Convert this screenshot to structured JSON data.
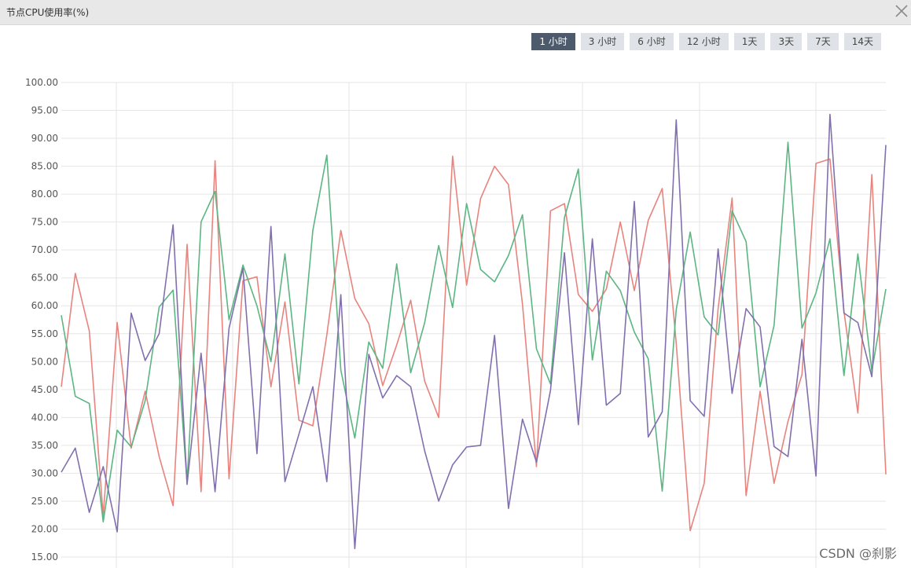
{
  "window": {
    "title": "节点CPU使用率(%)",
    "close_icon": "close-icon"
  },
  "range": {
    "options": [
      "1 小时",
      "3 小时",
      "6 小时",
      "12 小时",
      "1天",
      "3天",
      "7天",
      "14天"
    ],
    "selected": "1 小时"
  },
  "watermark": "CSDN @刹影",
  "chart_data": {
    "type": "line",
    "title": "",
    "xlabel": "",
    "ylabel": "",
    "ylim": [
      15,
      100
    ],
    "yticks": [
      "15.00",
      "20.00",
      "25.00",
      "30.00",
      "35.00",
      "40.00",
      "45.00",
      "50.00",
      "55.00",
      "60.00",
      "65.00",
      "70.00",
      "75.00",
      "80.00",
      "85.00",
      "90.00",
      "95.00",
      "100.00"
    ],
    "grid": true,
    "legend": "none",
    "x": [
      0,
      1,
      2,
      3,
      4,
      5,
      6,
      7,
      8,
      9,
      10,
      11,
      12,
      13,
      14,
      15,
      16,
      17,
      18,
      19,
      20,
      21,
      22,
      23,
      24,
      25,
      26,
      27,
      28,
      29,
      30,
      31,
      32,
      33,
      34,
      35,
      36,
      37,
      38,
      39,
      40,
      41,
      42,
      43,
      44,
      45,
      46,
      47,
      48,
      49,
      50,
      51,
      52,
      53,
      54,
      55,
      56,
      57,
      58,
      59,
      60,
      61,
      62,
      63
    ],
    "series": [
      {
        "color": "#e8837d",
        "values": [
          45.5,
          65.8,
          55.5,
          22.3,
          57.0,
          34.5,
          44.7,
          33.0,
          24.2,
          71.0,
          26.7,
          86.0,
          29.0,
          64.5,
          65.2,
          45.5,
          60.7,
          39.5,
          38.5,
          54.8,
          73.5,
          61.3,
          56.8,
          45.7,
          53.0,
          61.0,
          46.5,
          40.0,
          86.8,
          63.7,
          79.2,
          85.0,
          81.7,
          60.3,
          31.2,
          77.0,
          78.3,
          62.0,
          59.0,
          63.0,
          75.0,
          62.7,
          75.3,
          81.0,
          53.3,
          19.7,
          28.2,
          59.5,
          79.3,
          26.0,
          44.7,
          28.2,
          39.3,
          47.7,
          85.5,
          86.3,
          59.0,
          40.8,
          83.5,
          29.8
        ]
      },
      {
        "color": "#5cb583",
        "values": [
          58.3,
          43.8,
          42.5,
          21.3,
          37.7,
          34.7,
          43.0,
          59.8,
          62.8,
          28.3,
          75.0,
          80.5,
          57.5,
          67.3,
          60.0,
          50.0,
          69.3,
          46.0,
          73.5,
          87.0,
          48.5,
          36.3,
          53.5,
          48.8,
          67.5,
          48.0,
          57.0,
          70.8,
          59.7,
          78.3,
          66.5,
          64.3,
          69.0,
          76.3,
          52.3,
          46.0,
          75.8,
          84.5,
          50.3,
          66.2,
          62.7,
          55.3,
          50.5,
          26.8,
          59.3,
          73.2,
          58.0,
          54.8,
          77.0,
          71.5,
          45.5,
          56.5,
          89.3,
          56.0,
          62.3,
          72.0,
          47.5,
          69.3,
          48.3,
          63.0
        ]
      },
      {
        "color": "#8170ad",
        "values": [
          30.2,
          34.5,
          23.0,
          31.2,
          19.5,
          58.7,
          50.2,
          55.0,
          74.5,
          28.0,
          51.5,
          26.7,
          56.0,
          66.7,
          33.5,
          74.2,
          28.5,
          37.0,
          45.5,
          28.5,
          62.0,
          16.5,
          51.3,
          43.5,
          47.5,
          45.5,
          34.0,
          25.0,
          31.5,
          34.7,
          35.0,
          54.7,
          23.7,
          39.7,
          32.0,
          44.8,
          69.5,
          38.7,
          72.0,
          42.2,
          44.3,
          78.7,
          36.5,
          41.0,
          93.3,
          43.0,
          40.2,
          70.2,
          44.3,
          59.5,
          56.2,
          34.8,
          33.0,
          54.0,
          29.5,
          94.3,
          58.7,
          57.0,
          47.3,
          88.8
        ]
      }
    ]
  }
}
